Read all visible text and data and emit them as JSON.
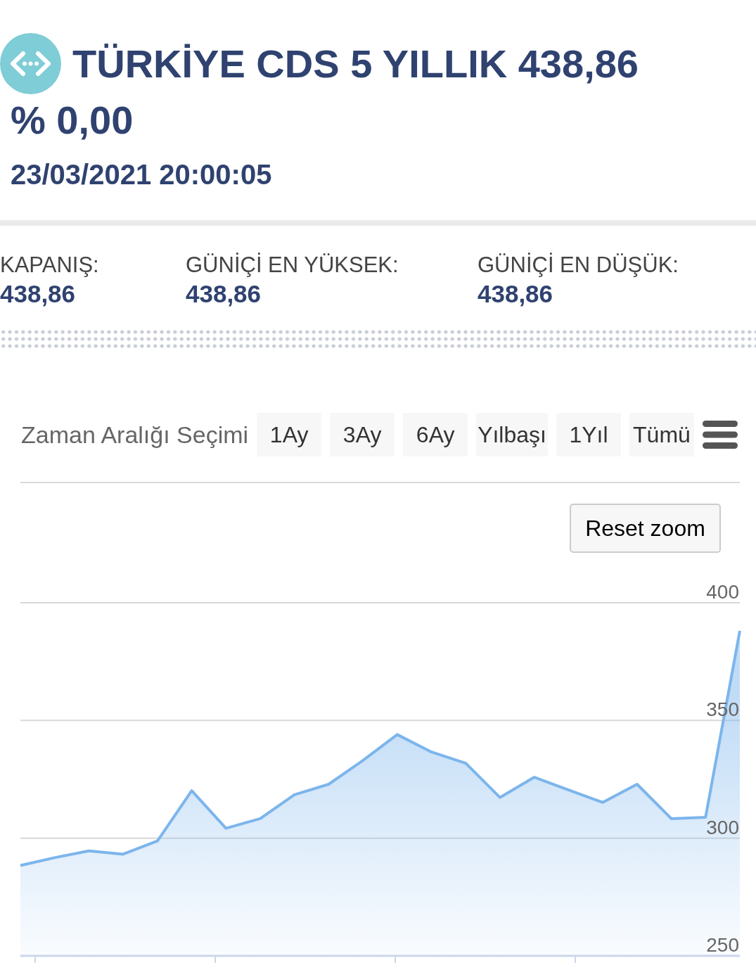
{
  "header": {
    "title": "TÜRKİYE CDS 5 YILLIK 438,86",
    "change": "% 0,00",
    "timestamp": "23/03/2021 20:00:05"
  },
  "stats": [
    {
      "label": "KAPANIŞ:",
      "value": "438,86"
    },
    {
      "label": "GÜNİÇİ EN YÜKSEK:",
      "value": "438,86"
    },
    {
      "label": "GÜNİÇİ EN DÜŞÜK:",
      "value": "438,86"
    }
  ],
  "range_selector": {
    "label": "Zaman Aralığı Seçimi",
    "buttons": [
      {
        "label": "1Ay",
        "selected": false
      },
      {
        "label": "3Ay",
        "selected": false
      },
      {
        "label": "6Ay",
        "selected": false
      },
      {
        "label": "Yılbaşı",
        "selected": false
      },
      {
        "label": "1Yıl",
        "selected": false
      },
      {
        "label": "Tümü",
        "selected": false
      }
    ]
  },
  "chart": {
    "reset_button": "Reset zoom",
    "chart_data": {
      "type": "area",
      "categories": [
        null,
        null,
        null,
        null,
        null,
        null,
        null,
        null,
        null,
        null,
        null,
        null,
        null,
        null,
        null,
        null,
        null,
        null,
        null,
        null,
        null,
        null
      ],
      "values": [
        288.4,
        291.7,
        294.6,
        293.2,
        298.8,
        320.2,
        304.2,
        308.3,
        318.5,
        322.9,
        333.0,
        344.0,
        336.6,
        331.8,
        317.3,
        325.9,
        320.5,
        315.2,
        322.9,
        308.3,
        308.9,
        388.1
      ],
      "ylim": [
        250,
        400
      ],
      "yticks": [
        250,
        300,
        350,
        400
      ]
    }
  }
}
